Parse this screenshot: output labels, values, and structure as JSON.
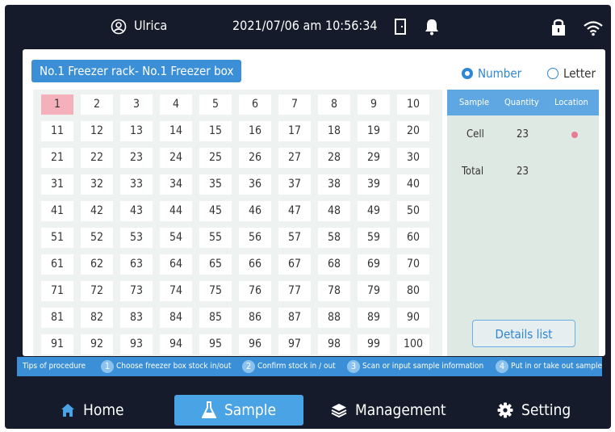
{
  "status_bar": {
    "username": "Ulrica",
    "datetime": "2021/07/06 am 10:56:34"
  },
  "panel": {
    "title": "No.1 Freezer rack- No.1 Freezer box",
    "radio_number_label": "Number",
    "radio_letter_label": "Letter",
    "selected_mode": "Number"
  },
  "grid": {
    "cells": [
      "1",
      "2",
      "3",
      "4",
      "5",
      "6",
      "7",
      "8",
      "9",
      "10",
      "11",
      "12",
      "13",
      "14",
      "15",
      "16",
      "17",
      "18",
      "19",
      "20",
      "21",
      "22",
      "23",
      "24",
      "25",
      "26",
      "27",
      "28",
      "29",
      "30",
      "31",
      "32",
      "33",
      "34",
      "35",
      "36",
      "37",
      "38",
      "39",
      "40",
      "41",
      "42",
      "43",
      "44",
      "45",
      "46",
      "47",
      "48",
      "49",
      "50",
      "51",
      "52",
      "53",
      "54",
      "55",
      "56",
      "57",
      "58",
      "59",
      "60",
      "61",
      "62",
      "63",
      "64",
      "65",
      "66",
      "67",
      "68",
      "69",
      "70",
      "71",
      "72",
      "73",
      "74",
      "75",
      "76",
      "77",
      "78",
      "79",
      "80",
      "81",
      "82",
      "83",
      "84",
      "85",
      "86",
      "87",
      "88",
      "89",
      "90",
      "91",
      "92",
      "93",
      "94",
      "95",
      "96",
      "97",
      "98",
      "99",
      "100"
    ],
    "selected": "1"
  },
  "side_table": {
    "headers": {
      "sample": "Sample",
      "quantity": "Quantity",
      "location": "Location"
    },
    "rows": [
      {
        "sample": "Cell",
        "quantity": "23",
        "location_color": "#e87c93"
      },
      {
        "sample": "Total",
        "quantity": "23"
      }
    ],
    "details_button": "Details list"
  },
  "tips": {
    "label": "Tips of procedure",
    "steps": [
      {
        "n": "1",
        "text": "Choose freezer box stock in/out"
      },
      {
        "n": "2",
        "text": "Confirm stock in / out"
      },
      {
        "n": "3",
        "text": "Scan or input sample information"
      },
      {
        "n": "4",
        "text": "Put in or take out sample"
      }
    ]
  },
  "nav": {
    "home": "Home",
    "sample": "Sample",
    "management": "Management",
    "setting": "Setting",
    "active": "Sample"
  },
  "colors": {
    "accent": "#3a8fd6",
    "selected_cell": "#f4b1bb",
    "background": "#161b2c"
  }
}
